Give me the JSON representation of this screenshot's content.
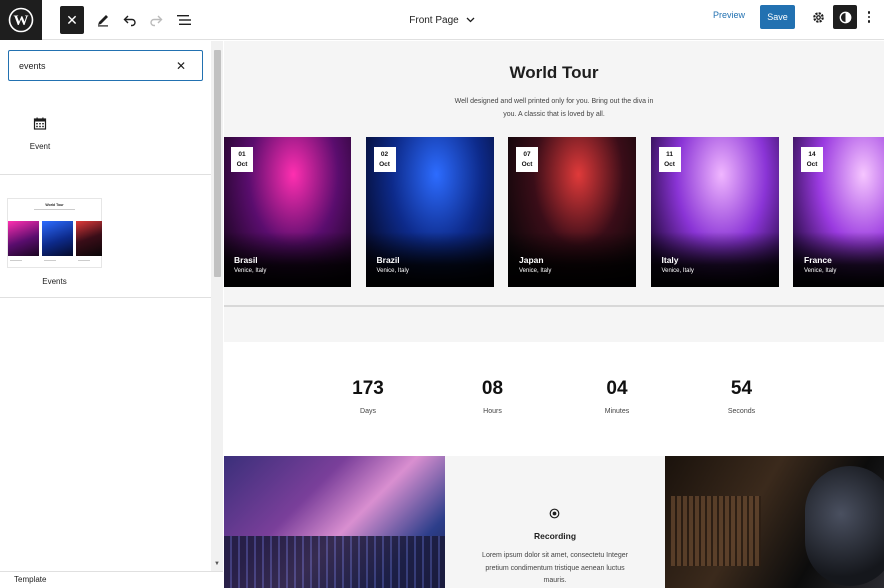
{
  "toolbar": {
    "document_title": "Front Page",
    "preview_label": "Preview",
    "save_label": "Save"
  },
  "sidebar": {
    "search_value": "events",
    "block_result": {
      "label": "Event",
      "icon": "calendar-icon"
    },
    "pattern_result": {
      "label": "Events",
      "preview_title": "World Tour"
    },
    "footer_breadcrumb": "Template"
  },
  "canvas": {
    "title": "World Tour",
    "description": "Well designed and well printed only for you. Bring out the diva in you. A classic that is loved by all.",
    "events": [
      {
        "day": "01",
        "month": "Oct",
        "city": "Brasil",
        "venue": "Venice, Italy",
        "colors": [
          "#ff2fb0",
          "#5a0d6e",
          "#1b0520"
        ]
      },
      {
        "day": "02",
        "month": "Oct",
        "city": "Brazil",
        "venue": "Venice, Italy",
        "colors": [
          "#2d6cff",
          "#0d2a8a",
          "#050a2a"
        ]
      },
      {
        "day": "07",
        "month": "Oct",
        "city": "Japan",
        "venue": "Venice, Italy",
        "colors": [
          "#e03a3a",
          "#3a0d18",
          "#0a0608"
        ]
      },
      {
        "day": "11",
        "month": "Oct",
        "city": "Italy",
        "venue": "Venice, Italy",
        "colors": [
          "#f0b6ff",
          "#8a34d6",
          "#200838"
        ]
      },
      {
        "day": "14",
        "month": "Oct",
        "city": "France",
        "venue": "Venice, Italy",
        "colors": [
          "#f6c6ff",
          "#9a3ae0",
          "#240a40"
        ]
      }
    ],
    "countdown": [
      {
        "value": "173",
        "label": "Days"
      },
      {
        "value": "08",
        "label": "Hours"
      },
      {
        "value": "04",
        "label": "Minutes"
      },
      {
        "value": "54",
        "label": "Seconds"
      }
    ],
    "feature": {
      "title": "Recording",
      "text": "Lorem ipsum dolor sit amet, consectetu Integer pretium condimentum tristique aenean luctus mauris."
    }
  },
  "colors": {
    "accent": "#2271b1",
    "dark": "#1e1e1e",
    "canvas_bg": "#f5f5f5"
  }
}
